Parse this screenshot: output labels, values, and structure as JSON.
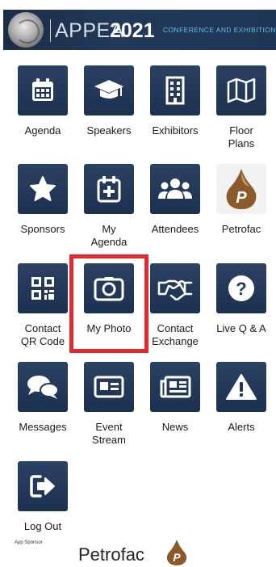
{
  "header": {
    "brand": "APPEA",
    "year": "2021",
    "tagline": "CONFERENCE AND EXHIBITION"
  },
  "menu": [
    {
      "label": "Agenda",
      "icon": "calendar-icon"
    },
    {
      "label": "Speakers",
      "icon": "graduation-cap-icon"
    },
    {
      "label": "Exhibitors",
      "icon": "building-icon"
    },
    {
      "label": "Floor\nPlans",
      "icon": "map-icon"
    },
    {
      "label": "Sponsors",
      "icon": "star-icon"
    },
    {
      "label": "My\nAgenda",
      "icon": "calendar-plus-icon"
    },
    {
      "label": "Attendees",
      "icon": "users-icon"
    },
    {
      "label": "Petrofac",
      "icon": "petrofac-logo-icon"
    },
    {
      "label": "Contact\nQR Code",
      "icon": "qr-code-icon"
    },
    {
      "label": "My Photo",
      "icon": "camera-icon"
    },
    {
      "label": "Contact\nExchange",
      "icon": "handshake-icon"
    },
    {
      "label": "Live Q & A",
      "icon": "question-icon"
    },
    {
      "label": "Messages",
      "icon": "chat-bubbles-icon"
    },
    {
      "label": "Event\nStream",
      "icon": "id-card-icon"
    },
    {
      "label": "News",
      "icon": "newspaper-icon"
    },
    {
      "label": "Alerts",
      "icon": "warning-icon"
    },
    {
      "label": "Log Out",
      "icon": "sign-out-icon"
    }
  ],
  "sponsor": {
    "tag": "App Sponsor",
    "name": "Petrofac"
  },
  "colors": {
    "tile": "#22385a",
    "highlight": "#e2292e",
    "petrofac_brown": "#7a4e22"
  }
}
